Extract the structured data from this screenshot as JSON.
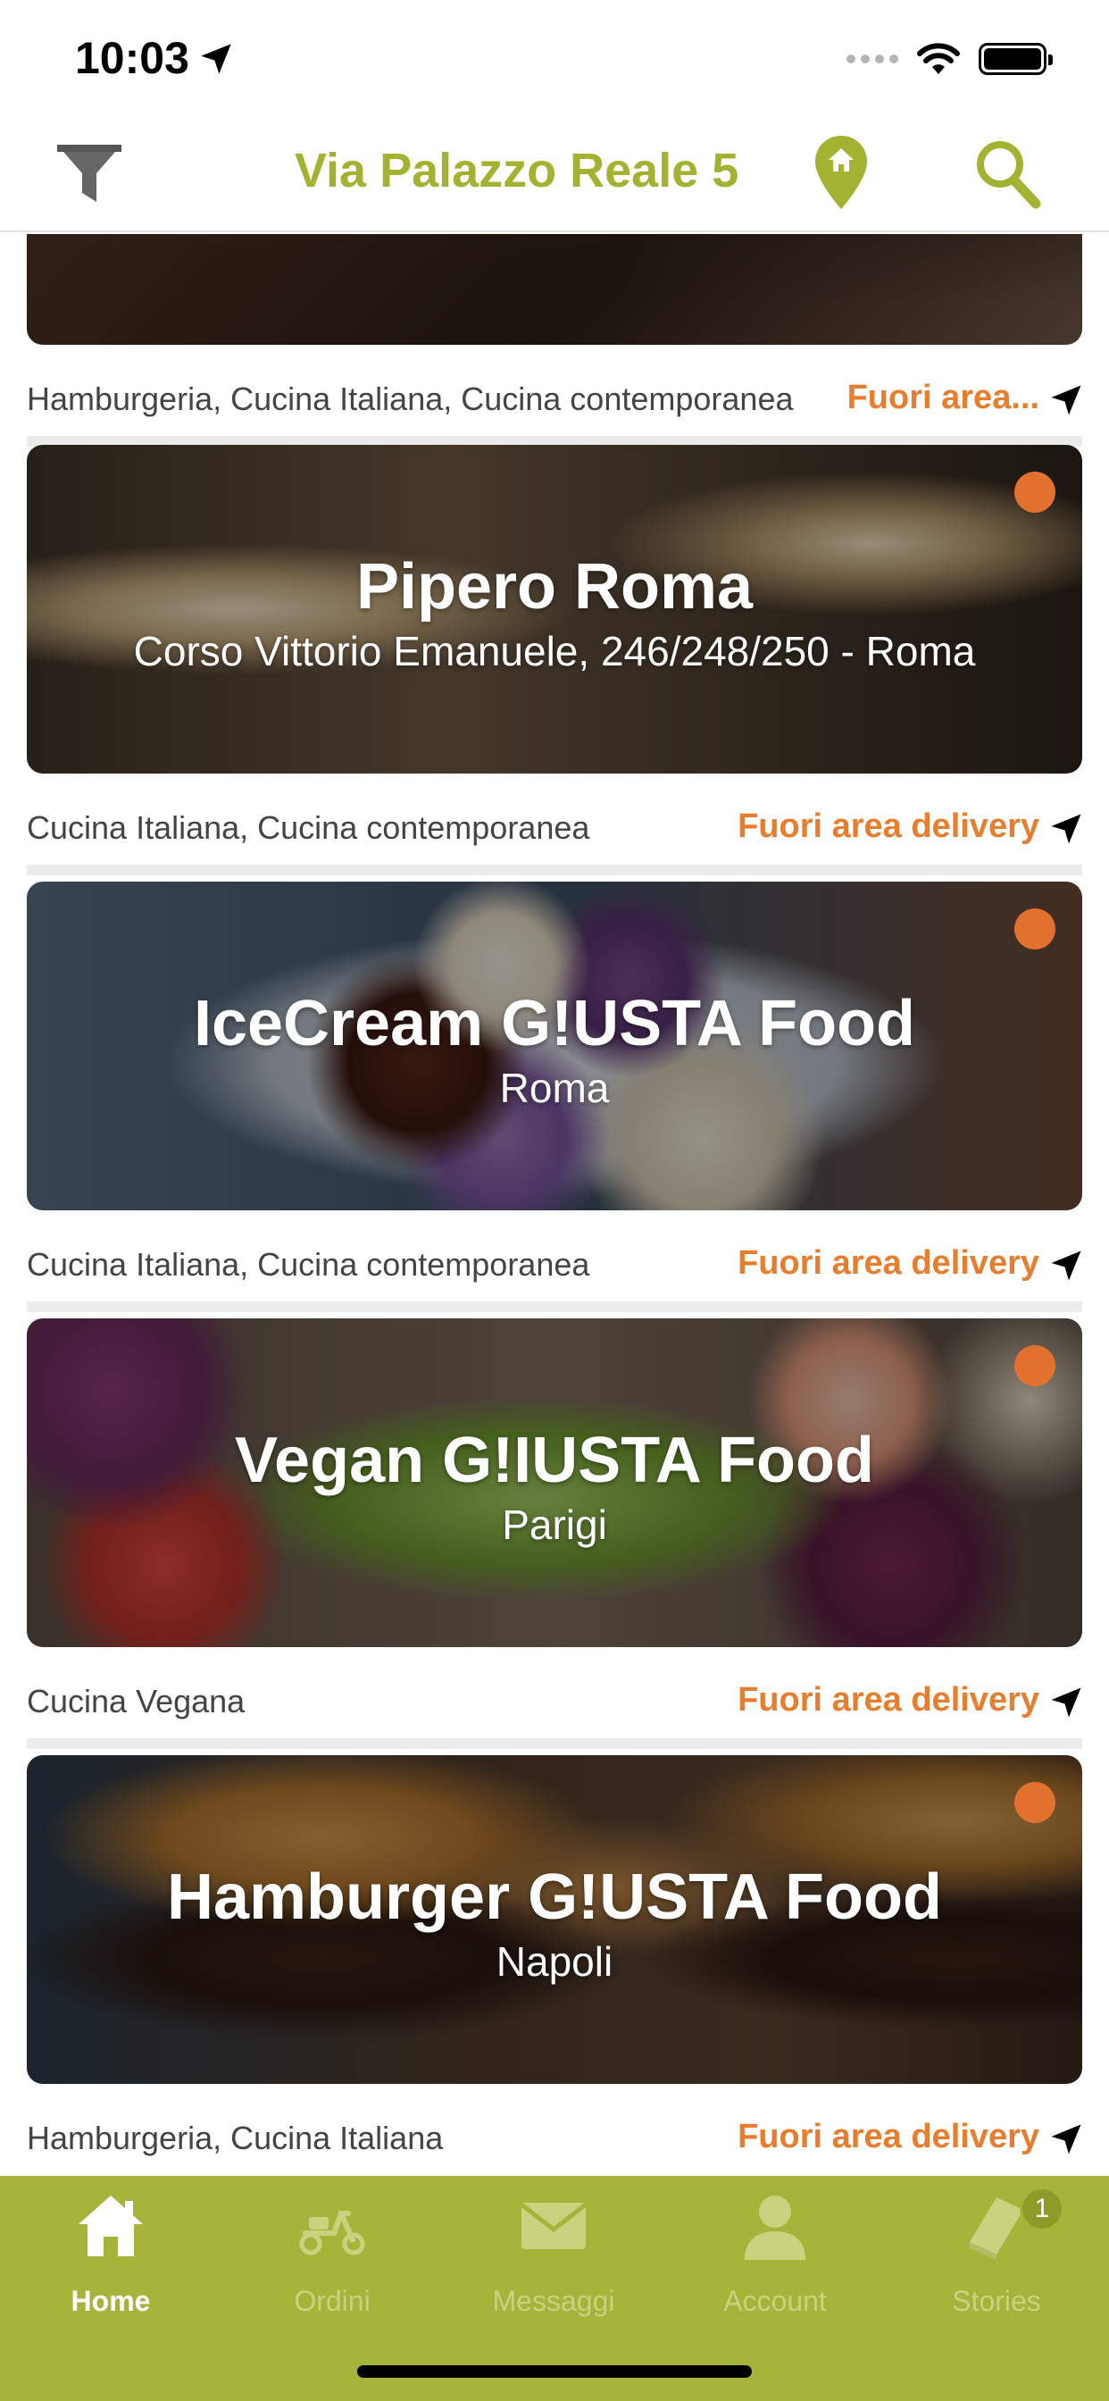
{
  "status_bar": {
    "time": "10:03"
  },
  "header": {
    "address": "Via Palazzo Reale 5"
  },
  "restaurants": [
    {
      "name": "",
      "location": "",
      "cuisine": "Hamburgeria, Cucina Italiana, Cucina contemporanea",
      "delivery_status": "Fuori area..."
    },
    {
      "name": "Pipero Roma",
      "location": "Corso Vittorio Emanuele, 246/248/250 - Roma",
      "cuisine": "Cucina Italiana, Cucina contemporanea",
      "delivery_status": "Fuori area delivery"
    },
    {
      "name": "IceCream G!USTA Food",
      "location": "Roma",
      "cuisine": "Cucina Italiana, Cucina contemporanea",
      "delivery_status": "Fuori area delivery"
    },
    {
      "name": "Vegan G!IUSTA Food",
      "location": "Parigi",
      "cuisine": "Cucina Vegana",
      "delivery_status": "Fuori area delivery"
    },
    {
      "name": "Hamburger G!USTA Food",
      "location": "Napoli",
      "cuisine": "Hamburgeria, Cucina Italiana",
      "delivery_status": "Fuori area delivery"
    }
  ],
  "tabs": [
    {
      "label": "Home",
      "icon": "home-icon",
      "active": true
    },
    {
      "label": "Ordini",
      "icon": "scooter-icon",
      "active": false
    },
    {
      "label": "Messaggi",
      "icon": "envelope-icon",
      "active": false
    },
    {
      "label": "Account",
      "icon": "person-icon",
      "active": false
    },
    {
      "label": "Stories",
      "icon": "book-icon",
      "active": false,
      "badge": "1"
    }
  ],
  "colors": {
    "brand_green": "#a6b43a",
    "title_green": "#a4b232",
    "delivery_orange": "#e87d2e",
    "status_dot": "#e2712f"
  }
}
